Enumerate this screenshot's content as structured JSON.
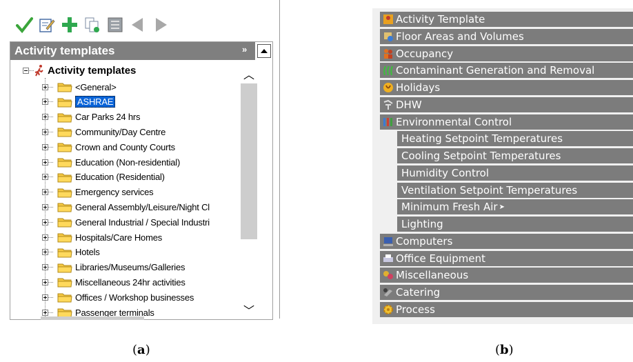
{
  "panel_a": {
    "toolbar": [
      {
        "name": "apply-check-icon",
        "color": "#3aa53a"
      },
      {
        "name": "edit-icon"
      },
      {
        "name": "add-plus-icon",
        "color": "#2fa84f"
      },
      {
        "name": "copy-icon"
      },
      {
        "name": "template-list-icon"
      },
      {
        "name": "back-arrow-icon"
      },
      {
        "name": "forward-arrow-icon"
      }
    ],
    "panel_title": "Activity templates",
    "tree_root_label": "Activity templates",
    "tree_items": [
      "<General>",
      "ASHRAE",
      "Car Parks 24 hrs",
      "Community/Day Centre",
      "Crown and County Courts",
      "Education (Non-residential)",
      "Education (Residential)",
      "Emergency services",
      "General Assembly/Leisure/Night Cl",
      "General Industrial / Special Industri",
      "Hospitals/Care Homes",
      "Hotels",
      "Libraries/Museums/Galleries",
      "Miscellaneous 24hr activities",
      "Offices / Workshop businesses",
      "Passenger terminals"
    ],
    "selected_item": "ASHRAE",
    "caption_open": "(",
    "caption_letter": "a",
    "caption_close": ")"
  },
  "panel_b": {
    "sections": [
      {
        "label": "Activity Template",
        "icon": "activity-template-icon",
        "level": 0
      },
      {
        "label": "Floor Areas and Volumes",
        "icon": "floor-areas-icon",
        "level": 0
      },
      {
        "label": "Occupancy",
        "icon": "occupancy-icon",
        "level": 0
      },
      {
        "label": "Contaminant Generation and Removal",
        "icon": "contaminant-icon",
        "level": 0
      },
      {
        "label": "Holidays",
        "icon": "holidays-icon",
        "level": 0
      },
      {
        "label": "DHW",
        "icon": "dhw-icon",
        "level": 0
      },
      {
        "label": "Environmental Control",
        "icon": "environmental-control-icon",
        "level": 0
      },
      {
        "label": "Heating Setpoint Temperatures",
        "level": 1
      },
      {
        "label": "Cooling Setpoint Temperatures",
        "level": 1
      },
      {
        "label": "Humidity Control",
        "level": 1
      },
      {
        "label": "Ventilation Setpoint Temperatures",
        "level": 1
      },
      {
        "label": "Minimum Fresh Air",
        "level": 1
      },
      {
        "label": "Lighting",
        "level": 1
      },
      {
        "label": "Computers",
        "icon": "computers-icon",
        "level": 0
      },
      {
        "label": "Office Equipment",
        "icon": "office-equipment-icon",
        "level": 0
      },
      {
        "label": "Miscellaneous",
        "icon": "miscellaneous-icon",
        "level": 0
      },
      {
        "label": "Catering",
        "icon": "catering-icon",
        "level": 0
      },
      {
        "label": "Process",
        "icon": "process-icon",
        "level": 0
      }
    ],
    "caption_open": "(",
    "caption_letter": "b",
    "caption_close": ")"
  },
  "colors": {
    "header_gray": "#7c7c7c",
    "selection_blue": "#0a64d8",
    "folder_yellow": "#f5c842"
  }
}
